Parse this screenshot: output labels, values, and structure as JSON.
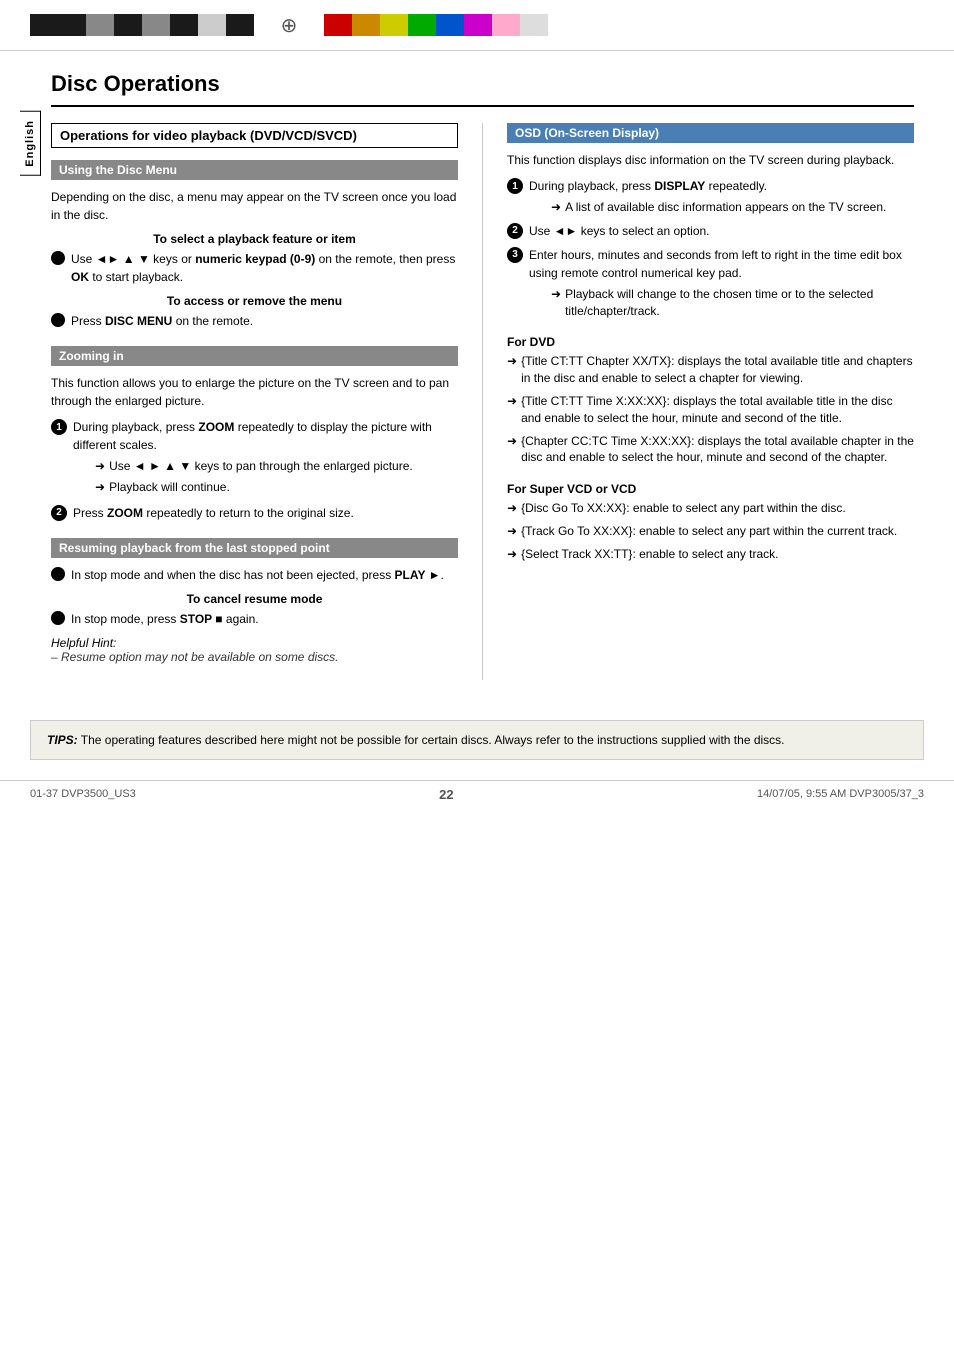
{
  "topbar": {
    "compass_symbol": "⊕"
  },
  "sidebar": {
    "label": "English"
  },
  "page_title": "Disc Operations",
  "left_col": {
    "section1": {
      "header": "Operations for video playback (DVD/VCD/SVCD)",
      "using_disc_menu": {
        "header": "Using the Disc Menu",
        "intro": "Depending on the disc, a menu may appear on the TV screen once you load in the disc.",
        "sub1": "To select a playback feature or item",
        "bullet1": "Use ◄► ▲ ▼ keys or numeric keypad (0-9) on the remote, then press OK to start playback.",
        "sub2": "To access or remove the menu",
        "bullet2": "Press DISC MENU on the remote."
      }
    },
    "section2": {
      "header": "Zooming in",
      "intro": "This function allows you to enlarge the picture on the TV screen and to pan through the enlarged picture.",
      "step1_text": "During playback, press ZOOM repeatedly to display the picture with different scales.",
      "step1_arrow1": "Use ◄ ► ▲ ▼ keys to pan through the enlarged picture.",
      "step1_arrow2": "Playback will continue.",
      "step2_text": "Press ZOOM repeatedly to return to the original size."
    },
    "section3": {
      "header": "Resuming playback from the last stopped point",
      "bullet1": "In stop mode and when the disc has not been ejected, press PLAY ►.",
      "sub1": "To cancel resume mode",
      "bullet2": "In stop mode, press STOP ■ again.",
      "hint_label": "Helpful Hint:",
      "hint_text": "–   Resume option may not be available on some discs."
    }
  },
  "right_col": {
    "osd": {
      "header": "OSD (On-Screen Display)",
      "intro": "This function displays disc information on the TV screen during playback.",
      "step1": "During playback, press DISPLAY repeatedly.",
      "step1_arrow": "A list of available disc information appears on the TV screen.",
      "step2": "Use ◄► keys to select an option.",
      "step3": "Enter hours, minutes and seconds from left to right in the time edit box using remote control numerical key pad.",
      "step3_arrow": "Playback will change to the chosen time or to the selected title/chapter/track."
    },
    "for_dvd": {
      "heading": "For DVD",
      "items": [
        "{Title CT:TT Chapter XX/TX}: displays the total available title and chapters in the disc and enable to select a chapter for viewing.",
        "{Title CT:TT Time X:XX:XX}: displays the total available title in the disc and enable to select the hour, minute and second of the title.",
        "{Chapter CC:TC Time X:XX:XX}: displays the total available chapter in the disc and enable to select the hour, minute and second of the chapter."
      ]
    },
    "for_svcd": {
      "heading": "For Super VCD or VCD",
      "items": [
        "{Disc Go To XX:XX}: enable to select any part within the disc.",
        "{Track Go To XX:XX}: enable to select any part within the current track.",
        "{Select Track XX:TT}: enable to select any track."
      ]
    }
  },
  "tips": {
    "label": "TIPS:",
    "text": "The operating features described here might not be possible for certain discs.  Always refer to the instructions supplied with the discs."
  },
  "footer": {
    "left": "01-37 DVP3500_US3",
    "center": "22",
    "right": "14/07/05, 9:55 AM DVP3005/37_3"
  },
  "colors": {
    "left_blocks": [
      "#1a1a1a",
      "#1a1a1a",
      "#888888",
      "#1a1a1a",
      "#888888",
      "#1a1a1a",
      "#cccccc",
      "#1a1a1a"
    ],
    "right_blocks": [
      "#cc0000",
      "#cc8800",
      "#cccc00",
      "#00aa00",
      "#0055cc",
      "#cc00cc",
      "#ffaacc",
      "#dddddd"
    ]
  }
}
